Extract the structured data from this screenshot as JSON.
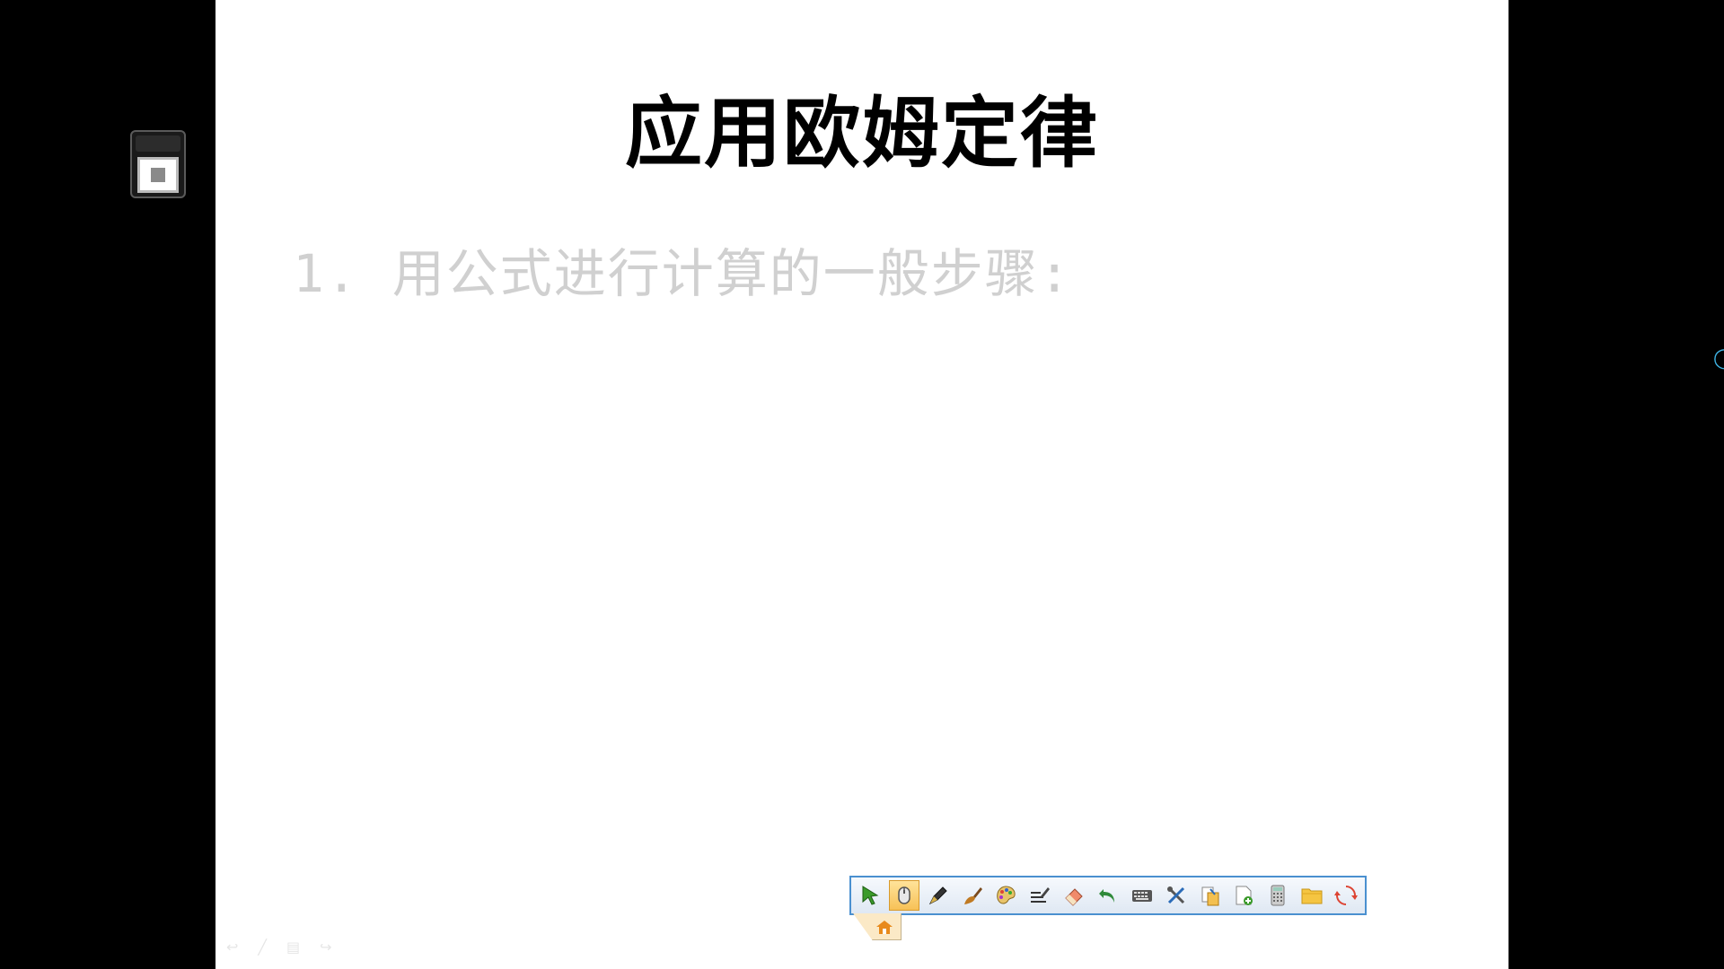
{
  "slide": {
    "title": "应用欧姆定律",
    "bullet": "1. 用公式进行计算的一般步骤:"
  },
  "slide_nav": {
    "prev": "↩",
    "pen": "╱",
    "menu": "▤",
    "next": "↪"
  },
  "toolbar": {
    "tools": [
      {
        "name": "select-arrow-icon",
        "active": false
      },
      {
        "name": "mouse-icon",
        "active": true
      },
      {
        "name": "pen-icon",
        "active": false
      },
      {
        "name": "brush-icon",
        "active": false
      },
      {
        "name": "palette-icon",
        "active": false
      },
      {
        "name": "handwriting-icon",
        "active": false
      },
      {
        "name": "eraser-icon",
        "active": false
      },
      {
        "name": "undo-icon",
        "active": false
      },
      {
        "name": "keyboard-icon",
        "active": false
      },
      {
        "name": "tools-icon",
        "active": false
      },
      {
        "name": "screen-capture-icon",
        "active": false
      },
      {
        "name": "new-page-icon",
        "active": false
      },
      {
        "name": "calculator-icon",
        "active": false
      },
      {
        "name": "folder-icon",
        "active": false
      },
      {
        "name": "refresh-icon",
        "active": false
      }
    ]
  },
  "colors": {
    "toolbar_border": "#4a90d0",
    "active_tool": "#f7c157",
    "bullet_text": "#d0d0d0"
  }
}
